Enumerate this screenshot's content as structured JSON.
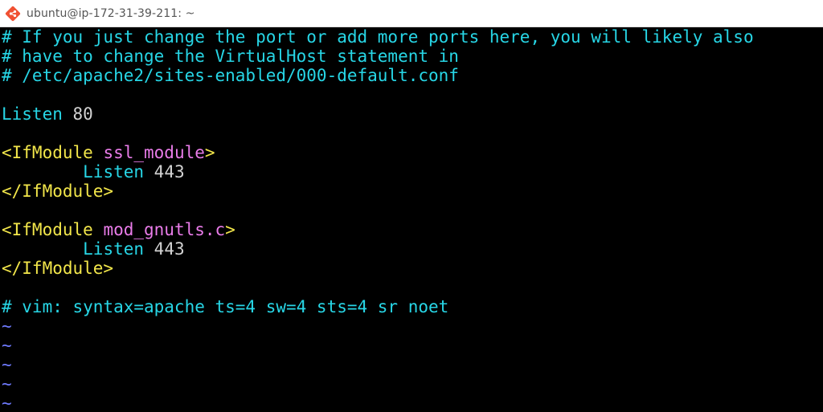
{
  "window": {
    "title": "ubuntu@ip-172-31-39-211: ~",
    "icon": "git-bash-diamond-icon"
  },
  "colors": {
    "comment": "#27d6e6",
    "keyword": "#27d6e6",
    "number": "#d2d2d2",
    "tag": "#f2e64a",
    "module": "#e97ce9",
    "tilde": "#6f7bff",
    "background": "#000000"
  },
  "editor": {
    "comment_1": "# If you just change the port or add more ports here, you will likely also",
    "comment_2": "# have to change the VirtualHost statement in",
    "comment_3": "# /etc/apache2/sites-enabled/000-default.conf",
    "listen_kw_1": "Listen",
    "listen_port_1": "80",
    "block1_open": "<IfModule",
    "block1_module": "ssl_module",
    "block1_close_angle": ">",
    "block1_listen_kw": "Listen",
    "block1_port": "443",
    "block1_end": "</IfModule>",
    "block2_open": "<IfModule",
    "block2_module": "mod_gnutls.c",
    "block2_close_angle": ">",
    "block2_listen_kw": "Listen",
    "block2_port": "443",
    "block2_end": "</IfModule>",
    "modeline": "# vim: syntax=apache ts=4 sw=4 sts=4 sr noet",
    "tilde": "~"
  }
}
